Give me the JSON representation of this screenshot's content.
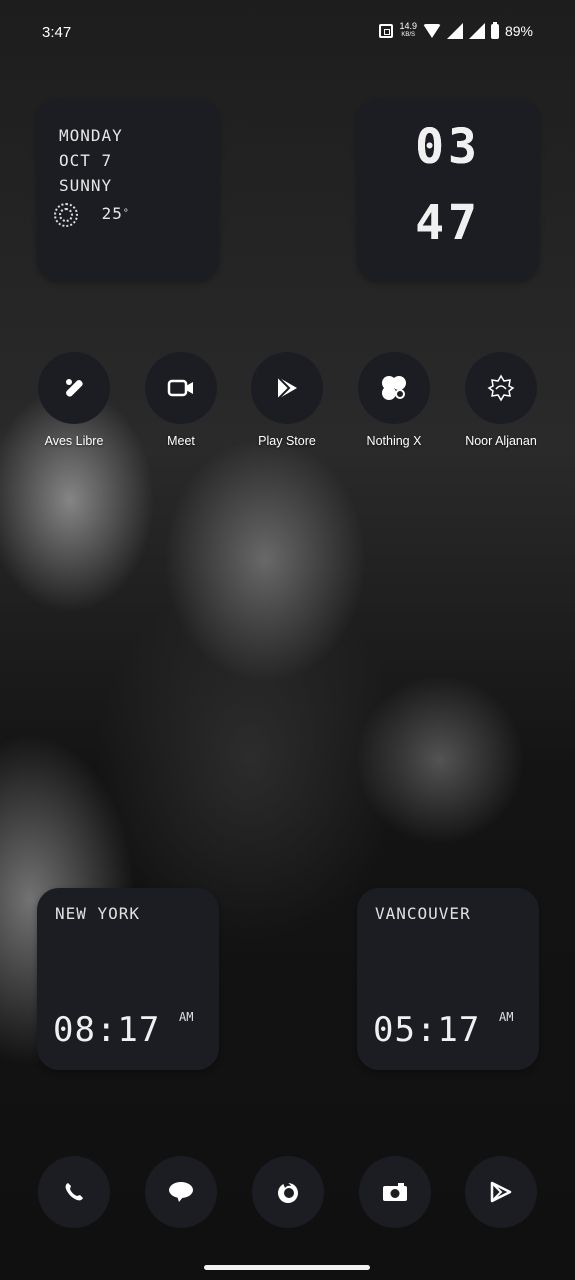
{
  "status_bar": {
    "time": "3:47",
    "net_speed_value": "14.9",
    "net_speed_unit": "KB/S",
    "battery": "89%"
  },
  "date_widget": {
    "day": "MONDAY",
    "date": "OCT 7",
    "weather": "SUNNY",
    "temperature": "25",
    "temperature_unit": "°"
  },
  "clock_widget": {
    "hour": "03",
    "minute": "47"
  },
  "apps": [
    {
      "label": "Aves Libre",
      "icon": "aves-libre-icon"
    },
    {
      "label": "Meet",
      "icon": "video-camera-icon"
    },
    {
      "label": "Play Store",
      "icon": "play-store-icon"
    },
    {
      "label": "Nothing X",
      "icon": "nothing-x-icon"
    },
    {
      "label": "Noor Aljanan",
      "icon": "noor-aljanan-icon"
    }
  ],
  "world_clocks": [
    {
      "city": "NEW YORK",
      "time": "08:17",
      "period": "AM"
    },
    {
      "city": "VANCOUVER",
      "time": "05:17",
      "period": "AM"
    }
  ],
  "dock": [
    {
      "icon": "phone-icon"
    },
    {
      "icon": "messages-icon"
    },
    {
      "icon": "firefox-icon"
    },
    {
      "icon": "camera-icon"
    },
    {
      "icon": "browser-icon"
    }
  ],
  "colors": {
    "widget_bg": "#1c1d22",
    "text": "#ffffff"
  }
}
